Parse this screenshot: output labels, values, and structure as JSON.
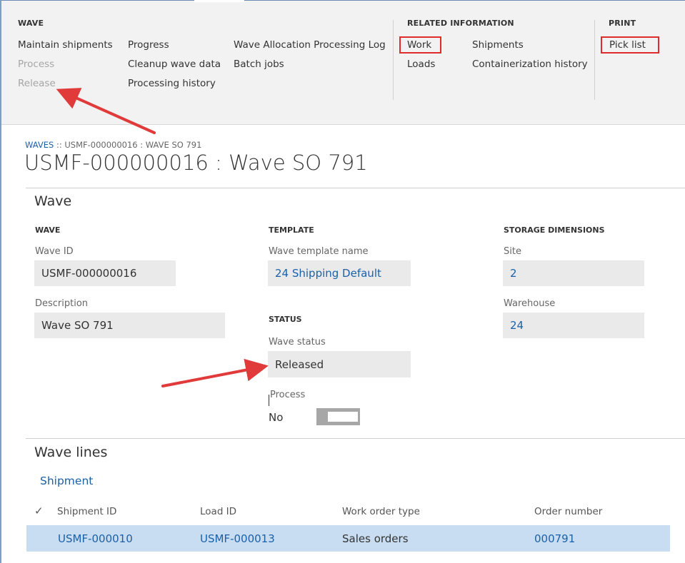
{
  "ribbon": {
    "wave_group": {
      "title": "WAVE",
      "items": [
        "Maintain shipments",
        "Process",
        "Release",
        "Progress",
        "Cleanup wave data",
        "Processing history",
        "Wave Allocation Processing Log",
        "Batch jobs"
      ]
    },
    "related_group": {
      "title": "RELATED INFORMATION",
      "items": [
        "Work",
        "Loads",
        "Shipments",
        "Containerization history"
      ]
    },
    "print_group": {
      "title": "PRINT",
      "items": [
        "Pick list"
      ]
    }
  },
  "header": {
    "breadcrumb_link": "WAVES",
    "breadcrumb_rest": " :: USMF-000000016 : WAVE SO 791",
    "title": "USMF-000000016 : Wave SO 791"
  },
  "wave_section": {
    "title": "Wave",
    "wave_col": {
      "heading": "WAVE",
      "wave_id_label": "Wave ID",
      "wave_id": "USMF-000000016",
      "description_label": "Description",
      "description": "Wave SO 791"
    },
    "template_col": {
      "heading": "TEMPLATE",
      "template_label": "Wave template name",
      "template": "24 Shipping Default"
    },
    "status_col": {
      "heading": "STATUS",
      "status_label": "Wave status",
      "status": "Released",
      "process_label": "Process",
      "process_value": "No"
    },
    "storage_col": {
      "heading": "STORAGE DIMENSIONS",
      "site_label": "Site",
      "site": "2",
      "warehouse_label": "Warehouse",
      "warehouse": "24"
    }
  },
  "wave_lines": {
    "title": "Wave lines",
    "tab": "Shipment",
    "columns": [
      "Shipment ID",
      "Load ID",
      "Work order type",
      "Order number"
    ],
    "rows": [
      {
        "shipment_id": "USMF-000010",
        "load_id": "USMF-000013",
        "work_order_type": "Sales orders",
        "order_number": "000791"
      }
    ]
  },
  "colors": {
    "link": "#1b61a8",
    "highlight_box": "#e02b2b",
    "selected_row": "#c8ddf1",
    "ribbon_bg": "#f2f2f2"
  }
}
